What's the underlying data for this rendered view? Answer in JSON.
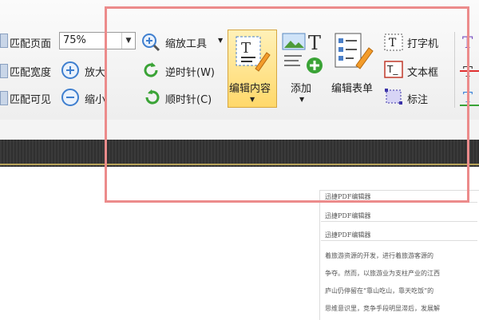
{
  "ribbon": {
    "fit_page": "匹配页面",
    "fit_width": "匹配宽度",
    "fit_visible": "匹配可见",
    "zoom_value": "75%",
    "zoom_in": "放大",
    "zoom_out": "缩小",
    "zoom_tool": "缩放工具",
    "rotate_ccw": "逆时针(W)",
    "rotate_cw": "顺时针(C)",
    "edit_content": "编辑内容",
    "add": "添加",
    "edit_form": "编辑表单",
    "typewriter": "打字机",
    "textbox": "文本框",
    "annotate": "标注"
  },
  "document": {
    "header1": "迅捷PDF编辑器",
    "header2": "迅捷PDF编辑器",
    "header3": "迅捷PDF编辑器",
    "para": [
      "着旅游资源的开发，进行着旅游客源的",
      "争夺。然而，以旅游业为支柱产业的江西",
      "庐山仍停留在“靠山吃山，靠天吃饭”的",
      "思维意识里，竞争手段明显滞后，发展解"
    ]
  },
  "colors": {
    "highlight": "#ec8b8b",
    "accent_blue": "#2f7bd6",
    "green": "#3aa336"
  }
}
